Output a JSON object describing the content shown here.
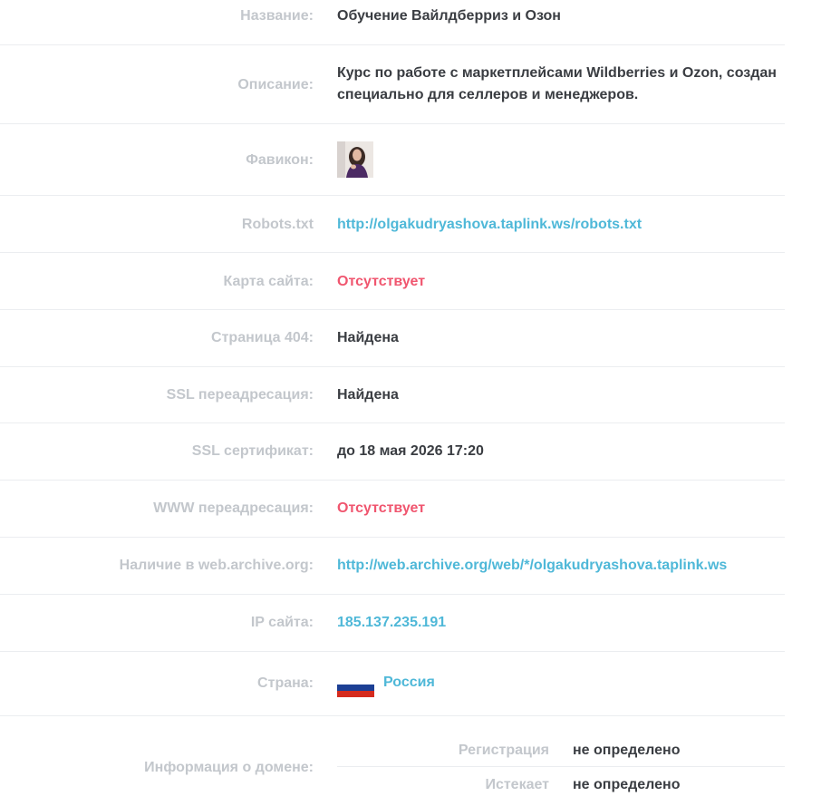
{
  "rows": {
    "name": {
      "label": "Название:",
      "value": "Обучение Вайлдберриз и Озон"
    },
    "description": {
      "label": "Описание:",
      "value": "Курс по работе с маркетплейсами Wildberries и Ozon, создан специально для селлеров и менеджеров."
    },
    "favicon": {
      "label": "Фавикон:"
    },
    "robots": {
      "label": "Robots.txt",
      "value": "http://olgakudryashova.taplink.ws/robots.txt"
    },
    "sitemap": {
      "label": "Карта сайта:",
      "value": "Отсутствует"
    },
    "page404": {
      "label": "Страница 404:",
      "value": "Найдена"
    },
    "ssl_redirect": {
      "label": "SSL переадресация:",
      "value": "Найдена"
    },
    "ssl_cert": {
      "label": "SSL сертификат:",
      "value": "до 18 мая 2026 17:20"
    },
    "www_redirect": {
      "label": "WWW переадресация:",
      "value": "Отсутствует"
    },
    "archive": {
      "label": "Наличие в web.archive.org:",
      "value": "http://web.archive.org/web/*/olgakudryashova.taplink.ws"
    },
    "ip": {
      "label": "IP сайта:",
      "value": "185.137.235.191"
    },
    "country": {
      "label": "Страна:",
      "value": "Россия",
      "flag_colors": [
        "#ffffff",
        "#1c3f94",
        "#d52b1e"
      ]
    },
    "domain": {
      "label": "Информация о домене:",
      "registration_label": "Регистрация",
      "registration_value": "не определено",
      "expires_label": "Истекает",
      "expires_value": "не определено"
    }
  },
  "colors": {
    "label": "#c3c7cc",
    "value": "#3a3d42",
    "link": "#4fb8d8",
    "missing": "#f0566f",
    "divider": "#ebedf0"
  }
}
